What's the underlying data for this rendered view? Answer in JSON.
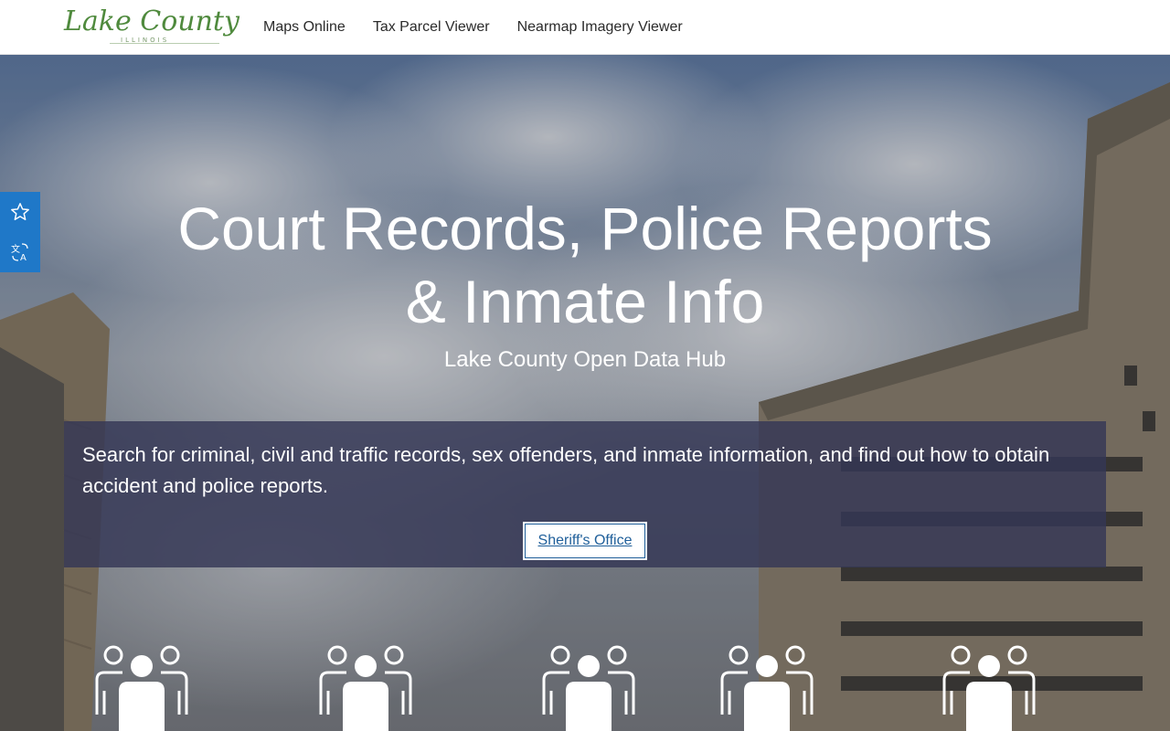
{
  "header": {
    "logo": {
      "script": "Lake County",
      "sub": "ILLINOIS"
    },
    "nav": [
      {
        "label": "Maps Online"
      },
      {
        "label": "Tax Parcel Viewer"
      },
      {
        "label": "Nearmap Imagery Viewer"
      }
    ]
  },
  "sidetools": [
    {
      "icon": "star-icon"
    },
    {
      "icon": "translate-icon"
    }
  ],
  "hero": {
    "title_line1": "Court Records, Police Reports",
    "title_line2": "& Inmate Info",
    "subtitle": "Lake County Open Data Hub"
  },
  "panel": {
    "text": "Search for criminal, civil and traffic records, sex offenders, and inmate information, and find out how to obtain accident and police reports.",
    "button_label": "Sheriff's Office"
  },
  "icons": [
    {
      "icon": "people-group-icon"
    },
    {
      "icon": "people-group-icon"
    },
    {
      "icon": "people-group-icon"
    },
    {
      "icon": "people-group-icon"
    },
    {
      "icon": "people-group-icon"
    }
  ],
  "colors": {
    "accent": "#1f78c8",
    "logo_green": "#4f8a3d",
    "panel": "#343756",
    "link": "#1f5f9a"
  }
}
